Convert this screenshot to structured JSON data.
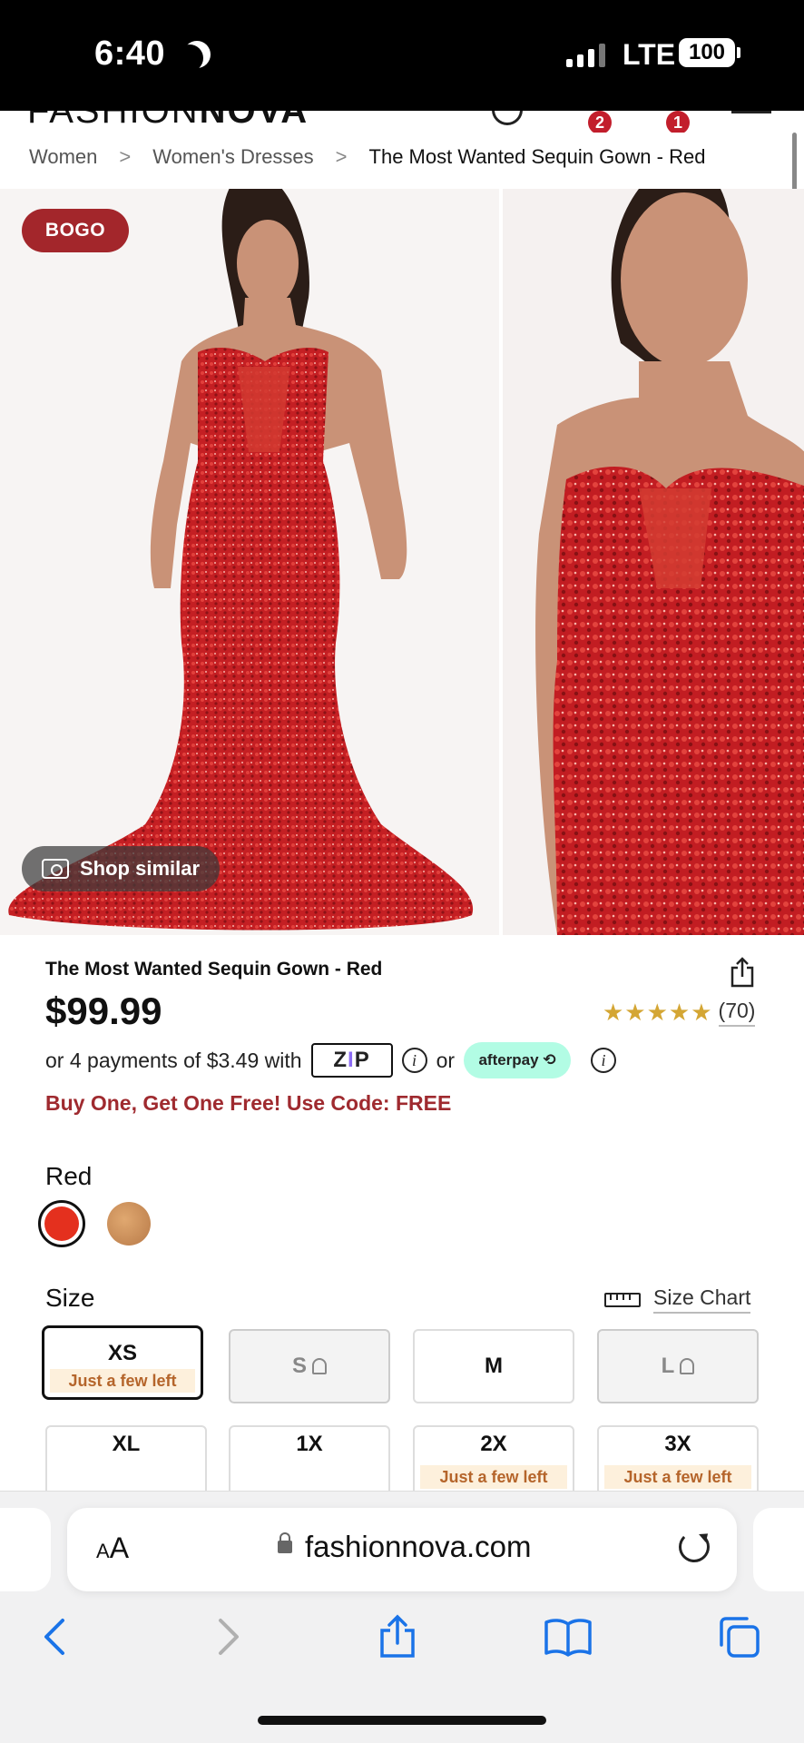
{
  "status_bar": {
    "time": "6:40",
    "network": "LTE",
    "battery": "100"
  },
  "header": {
    "logo_light": "FASHION",
    "logo_bold": "NOVA",
    "wishlist_count": "2",
    "cart_count": "1"
  },
  "breadcrumb": {
    "items": [
      "Women",
      "Women's Dresses",
      "The Most Wanted Sequin Gown - Red"
    ],
    "separator": ">"
  },
  "gallery": {
    "badge": "BOGO",
    "shop_similar_label": "Shop similar"
  },
  "product": {
    "title": "The Most Wanted Sequin Gown - Red",
    "price": "$99.99",
    "stars": "★★★★★",
    "rating_value": 5,
    "review_count": "(70)",
    "installments_text": "or 4 payments of $3.49 with",
    "zip_label": "ZIP",
    "or_label": "or",
    "afterpay_label": "afterpay",
    "promo": "Buy One, Get One Free! Use Code: FREE"
  },
  "color": {
    "label": "Red",
    "swatches": [
      {
        "name": "Red",
        "hex": "#e4301e",
        "selected": true
      },
      {
        "name": "Gold",
        "hex": "#c88a55",
        "selected": false
      }
    ]
  },
  "size": {
    "label": "Size",
    "chart_label": "Size Chart",
    "options": [
      {
        "label": "XS",
        "note": "Just a few left",
        "selected": true,
        "available": true
      },
      {
        "label": "S",
        "note": "",
        "selected": false,
        "available": false
      },
      {
        "label": "M",
        "note": "",
        "selected": false,
        "available": true
      },
      {
        "label": "L",
        "note": "",
        "selected": false,
        "available": false
      },
      {
        "label": "XL",
        "note": "",
        "selected": false,
        "available": true
      },
      {
        "label": "1X",
        "note": "",
        "selected": false,
        "available": true
      },
      {
        "label": "2X",
        "note": "Just a few left",
        "selected": false,
        "available": true
      },
      {
        "label": "3X",
        "note": "Just a few left",
        "selected": false,
        "available": true
      }
    ]
  },
  "browser": {
    "text_size_label": "AA",
    "url": "fashionnova.com"
  },
  "colors": {
    "brand_red": "#a3262b",
    "promo_red": "#9f2a2f",
    "star_gold": "#d4a634",
    "link_blue": "#1a73e8",
    "afterpay_mint": "#b2fce4"
  }
}
